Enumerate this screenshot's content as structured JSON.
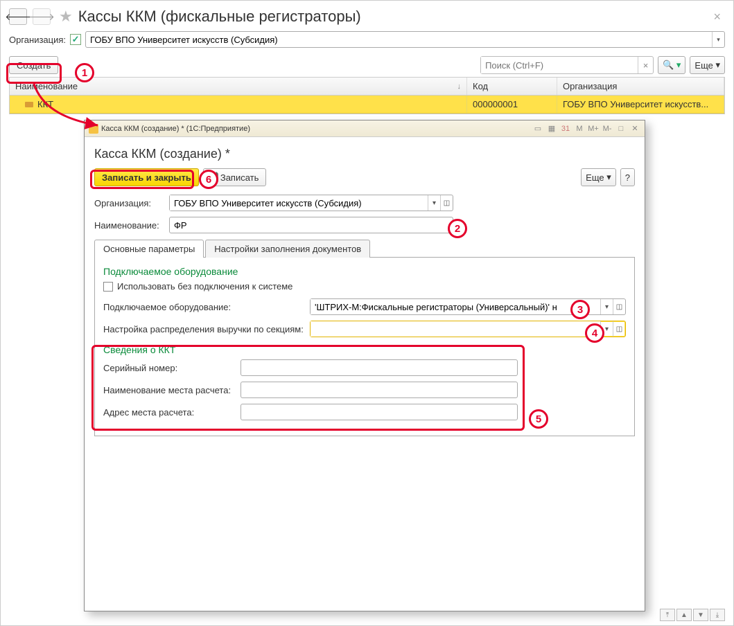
{
  "header": {
    "title": "Кассы ККМ (фискальные регистраторы)"
  },
  "filter": {
    "org_label": "Организация:",
    "org_value": "ГОБУ ВПО Университет искусств (Субсидия)"
  },
  "toolbar": {
    "create": "Создать",
    "search_placeholder": "Поиск (Ctrl+F)",
    "more": "Еще"
  },
  "table": {
    "cols": {
      "name": "Наименование",
      "code": "Код",
      "org": "Организация"
    },
    "row": {
      "name": "ККТ",
      "code": "000000001",
      "org": "ГОБУ ВПО Университет искусств..."
    }
  },
  "dialog": {
    "titlebar": "Касса ККМ (создание) *   (1С:Предприятие)",
    "mem_buttons": [
      "M",
      "M+",
      "M-"
    ],
    "heading": "Касса ККМ (создание) *",
    "save_close": "Записать и закрыть",
    "save": "Записать",
    "more": "Еще",
    "help": "?",
    "org_label": "Организация:",
    "org_value": "ГОБУ ВПО Университет искусств (Субсидия)",
    "name_label": "Наименование:",
    "name_value": "ФР",
    "tabs": {
      "main": "Основные параметры",
      "fill": "Настройки заполнения документов"
    },
    "sec_equip": "Подключаемое оборудование",
    "chk_offline": "Использовать без подключения к системе",
    "equip_label": "Подключаемое оборудование:",
    "equip_value": "'ШТРИХ-М:Фискальные регистраторы (Универсальный)' н",
    "sections_label": "Настройка распределения выручки по секциям:",
    "sections_value": "",
    "sec_kkt": "Сведения о ККТ",
    "serial_label": "Серийный номер:",
    "place_name_label": "Наименование места расчета:",
    "place_addr_label": "Адрес места расчета:"
  },
  "callouts": {
    "c1": "1",
    "c2": "2",
    "c3": "3",
    "c4": "4",
    "c5": "5",
    "c6": "6"
  }
}
